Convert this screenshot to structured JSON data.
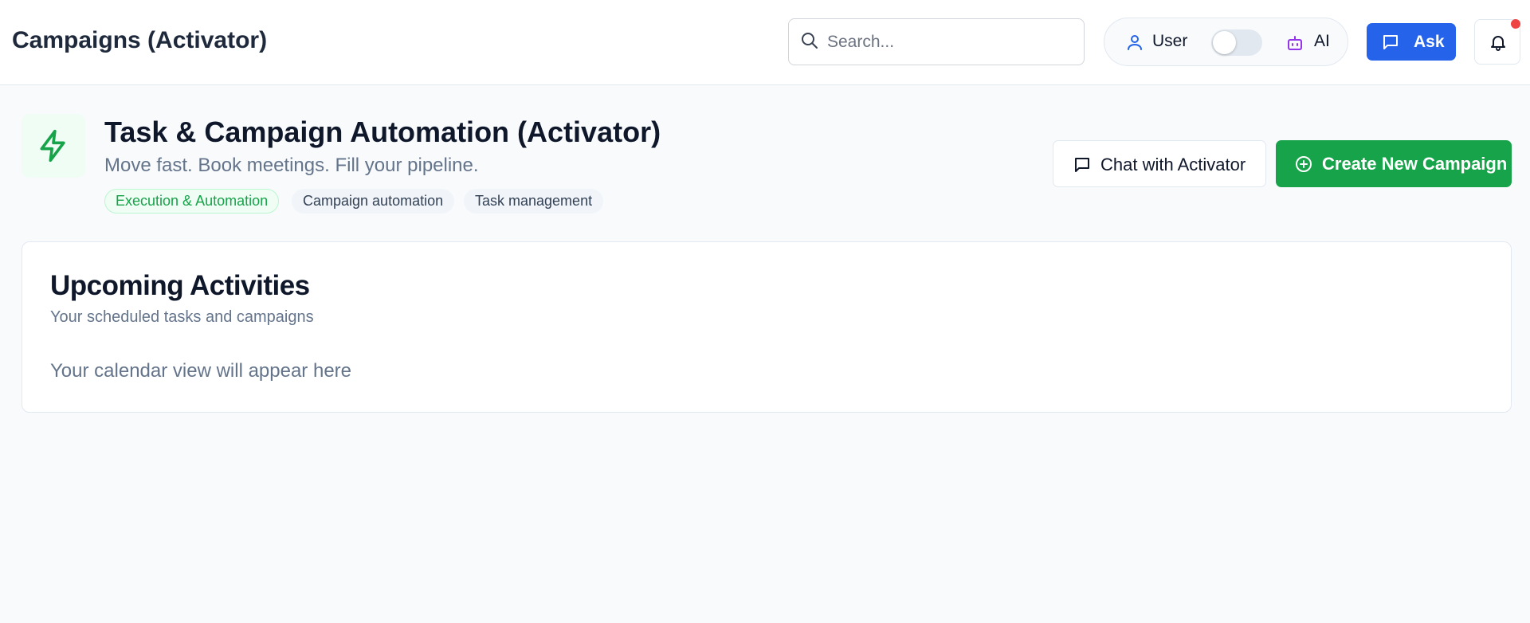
{
  "header": {
    "app_title": "Campaigns (Activator)",
    "search": {
      "placeholder": "Search...",
      "value": ""
    },
    "mode_toggle": {
      "user_label": "User",
      "ai_label": "AI",
      "ai_enabled": false
    },
    "ask_label": "Ask",
    "notifications": {
      "has_unread": true
    }
  },
  "agent": {
    "icon": "bolt-icon",
    "title": "Task & Campaign Automation (Activator)",
    "subtitle": "Move fast. Book meetings. Fill your pipeline.",
    "tags": [
      "Execution & Automation",
      "Campaign automation",
      "Task management"
    ],
    "chat_button_label": "Chat with Activator",
    "create_button_label": "Create New Campaign"
  },
  "activities": {
    "title": "Upcoming Activities",
    "subtitle": "Your scheduled tasks and campaigns",
    "placeholder": "Your calendar view will appear here"
  },
  "colors": {
    "primary_blue": "#2563eb",
    "accent_green": "#16a34a",
    "ai_purple": "#9333ea",
    "notification_red": "#ef4444"
  }
}
